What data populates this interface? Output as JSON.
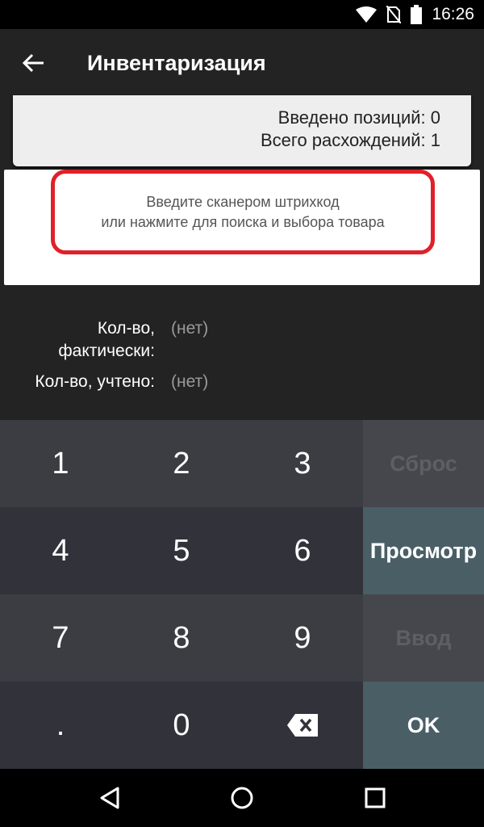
{
  "status_bar": {
    "time": "16:26",
    "icons": [
      "wifi-icon",
      "no-sim-icon",
      "battery-icon"
    ]
  },
  "app_bar": {
    "title": "Инвентаризация",
    "back_icon": "arrow-back-icon"
  },
  "summary": {
    "entered_positions": "Введено позиций: 0",
    "total_discrepancies": "Всего расхождений: 1"
  },
  "scan": {
    "line1": "Введите сканером штрихкод",
    "line2": "или нажмите для поиска и выбора товара"
  },
  "quantity": {
    "actual_label_line1": "Кол-во,",
    "actual_label_line2": "фактически:",
    "actual_value": "(нет)",
    "counted_label": "Кол-во, учтено:",
    "counted_value": "(нет)"
  },
  "keypad": {
    "keys": [
      "1",
      "2",
      "3",
      "4",
      "5",
      "6",
      "7",
      "8",
      "9",
      ".",
      "0"
    ],
    "backspace_icon": "backspace-icon",
    "reset_label": "Сброс",
    "view_label": "Просмотр",
    "enter_label": "Ввод",
    "ok_label": "OK"
  },
  "colors": {
    "highlight_border": "#e0202a",
    "active_side_key": "#4a5e66",
    "disabled_text": "#5e5e64"
  }
}
